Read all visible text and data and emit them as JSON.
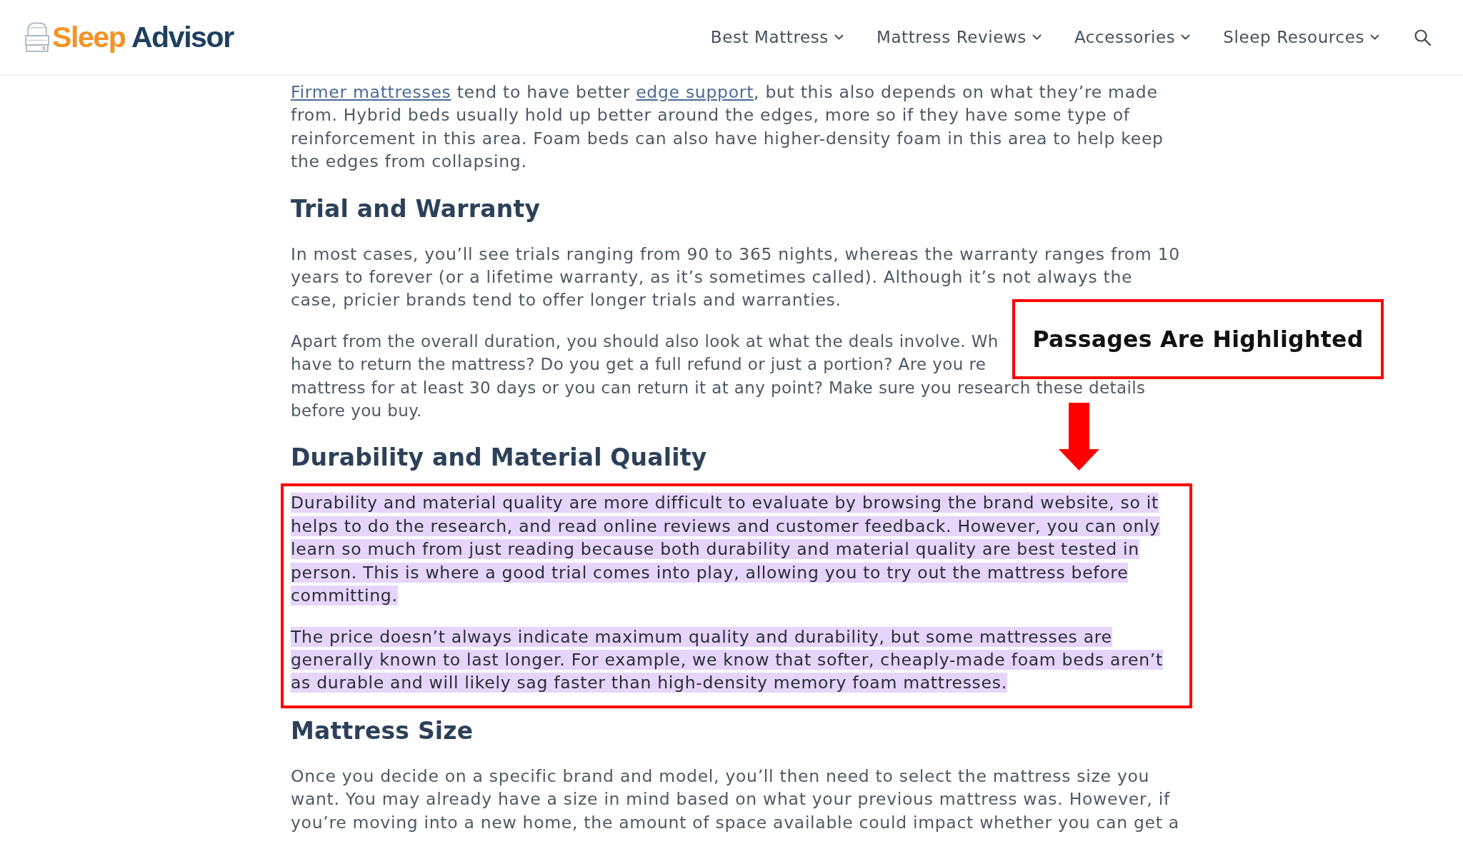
{
  "header": {
    "logo": {
      "parts": [
        "Sleep",
        "Advisor"
      ]
    },
    "nav": [
      {
        "label": "Best Mattress",
        "has_menu": true
      },
      {
        "label": "Mattress Reviews",
        "has_menu": true
      },
      {
        "label": "Accessories",
        "has_menu": true
      },
      {
        "label": "Sleep Resources",
        "has_menu": true
      }
    ]
  },
  "article": [
    {
      "kind": "paragraph",
      "highlighted": false,
      "segments": [
        {
          "kind": "link",
          "text": "Firmer mattresses"
        },
        {
          "kind": "text",
          "text": " tend to have better "
        },
        {
          "kind": "link",
          "text": "edge support"
        },
        {
          "kind": "text",
          "text": ", but this also depends on what they’re made from. Hybrid beds usually hold up better around the edges, more so if they have some type of reinforcement in this area. Foam beds can also have higher-density foam in this area to help keep the edges from collapsing."
        }
      ]
    },
    {
      "kind": "heading",
      "text": "Trial and Warranty"
    },
    {
      "kind": "paragraph",
      "highlighted": false,
      "text": "In most cases, you’ll see trials ranging from 90 to 365 nights, whereas the warranty ranges from 10 years to forever (or a lifetime warranty, as it’s sometimes called). Although it’s not always the case, pricier brands tend to offer longer trials and warranties."
    },
    {
      "kind": "paragraph",
      "highlighted": false,
      "lines": [
        "Apart from the overall duration, you should also look at what the deals involve. Wh",
        "have to return the mattress? Do you get a full refund or just a portion? Are you re",
        "mattress for at least 30 days or you can return it at any point? Make sure you research these details",
        "before you buy."
      ]
    },
    {
      "kind": "heading",
      "text": "Durability and Material Quality"
    },
    {
      "kind": "paragraph",
      "highlighted": true,
      "text": "Durability and material quality are more difficult to evaluate by browsing the brand website, so it helps to do the research, and read online reviews and customer feedback. However, you can only learn so much from just reading because both durability and material quality are best tested in person. This is where a good trial comes into play, allowing you to try out the mattress before committing."
    },
    {
      "kind": "paragraph",
      "highlighted": true,
      "text": "The price doesn’t always indicate maximum quality and durability, but some mattresses are generally known to last longer. For example, we know that softer, cheaply-made foam beds aren’t as durable and will likely sag faster than high-density memory foam mattresses."
    },
    {
      "kind": "heading",
      "text": "Mattress Size"
    },
    {
      "kind": "paragraph",
      "highlighted": false,
      "text": "Once you decide on a specific brand and model, you’ll then need to select the mattress size you want. You may already have a size in mind based on what your previous mattress was. However, if you’re moving into a new home, the amount of space available could impact whether you can get a"
    }
  ],
  "callout": {
    "text": "Passages Are Highlighted"
  }
}
